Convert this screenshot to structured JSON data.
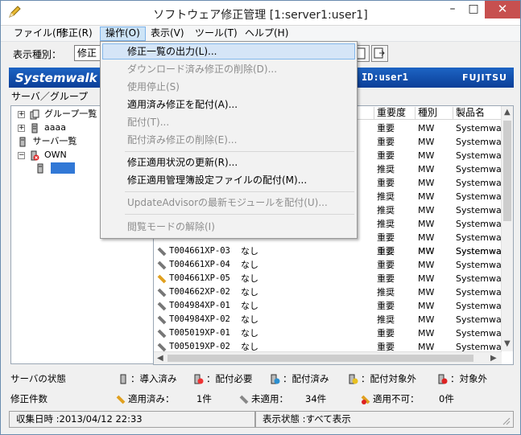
{
  "window": {
    "title": "ソフトウェア修正管理 [1:server1:user1]",
    "minimize": "–",
    "maximize": "□",
    "close": "✕"
  },
  "menubar": [
    {
      "label": "ファイル(F)"
    },
    {
      "label": "修正(R)"
    },
    {
      "label": "操作(O)"
    },
    {
      "label": "表示(V)"
    },
    {
      "label": "ツール(T)"
    },
    {
      "label": "ヘルプ(H)"
    }
  ],
  "toolbar": {
    "display_type_label": "表示種別：",
    "display_type_value": "修正"
  },
  "banner": {
    "logo": "Systemwalk",
    "user": "ID:user1",
    "brand": "FUJITSU"
  },
  "tree": {
    "header": "サーバ／グループ",
    "nodes": [
      {
        "label": "グループ一覧",
        "expander": "+"
      },
      {
        "label": "aaaa",
        "expander": "+"
      },
      {
        "label": "サーバ一覧",
        "expander": ""
      },
      {
        "label": "OWN",
        "expander": "−"
      },
      {
        "label": "",
        "expander": ""
      }
    ]
  },
  "list": {
    "columns": {
      "importance": "重要度",
      "kind": "種別",
      "product": "製品名"
    },
    "top_rows": [
      {
        "importance": "重要",
        "kind": "MW",
        "product": "Systemwa"
      },
      {
        "importance": "重要",
        "kind": "MW",
        "product": "Systemwa"
      },
      {
        "importance": "重要",
        "kind": "MW",
        "product": "Systemwa"
      },
      {
        "importance": "推奨",
        "kind": "MW",
        "product": "Systemwa"
      },
      {
        "importance": "重要",
        "kind": "MW",
        "product": "Systemwa"
      },
      {
        "importance": "推奨",
        "kind": "MW",
        "product": "Systemwa"
      },
      {
        "importance": "推奨",
        "kind": "MW",
        "product": "Systemwa"
      },
      {
        "importance": "推奨",
        "kind": "MW",
        "product": "Systemwa"
      },
      {
        "importance": "重要",
        "kind": "MW",
        "product": "Systemwa"
      },
      {
        "importance": "重要",
        "kind": "MW",
        "product": "Systemwa"
      }
    ],
    "rows": [
      {
        "id": "T004661XP-03",
        "status": "なし",
        "importance": "重要",
        "kind": "MW",
        "product": "Systemwa",
        "icon": "patch"
      },
      {
        "id": "T004661XP-04",
        "status": "なし",
        "importance": "重要",
        "kind": "MW",
        "product": "Systemwa",
        "icon": "patch"
      },
      {
        "id": "T004661XP-05",
        "status": "なし",
        "importance": "重要",
        "kind": "MW",
        "product": "Systemwa",
        "icon": "applied"
      },
      {
        "id": "T004662XP-02",
        "status": "なし",
        "importance": "推奨",
        "kind": "MW",
        "product": "Systemwa",
        "icon": "patch"
      },
      {
        "id": "T004984XP-01",
        "status": "なし",
        "importance": "重要",
        "kind": "MW",
        "product": "Systemwa",
        "icon": "patch"
      },
      {
        "id": "T004984XP-02",
        "status": "なし",
        "importance": "推奨",
        "kind": "MW",
        "product": "Systemwa",
        "icon": "patch"
      },
      {
        "id": "T005019XP-01",
        "status": "なし",
        "importance": "重要",
        "kind": "MW",
        "product": "Systemwa",
        "icon": "patch"
      },
      {
        "id": "T005019XP-02",
        "status": "なし",
        "importance": "重要",
        "kind": "MW",
        "product": "Systemwa",
        "icon": "patch"
      }
    ]
  },
  "legend": {
    "server_state_label": "サーバの状態",
    "installed": "：導入済み",
    "dist_required": "：配付必要",
    "distributed": "：配付済み",
    "dist_excluded": "：配付対象外",
    "excluded": "：対象外",
    "fix_count_label": "修正件数",
    "applied_label": "適用済み：",
    "applied_count": "1件",
    "not_applied_label": "未適用：",
    "not_applied_count": "34件",
    "cannot_apply_label": "適用不可：",
    "cannot_apply_count": "0件"
  },
  "statusbar": {
    "collected": "収集日時 :2013/04/12 22:33",
    "display_state": "表示状態 :すべて表示"
  },
  "operation_menu": [
    {
      "label": "修正一覧の出力(L)...",
      "enabled": true,
      "highlighted": true
    },
    {
      "label": "ダウンロード済み修正の削除(D)...",
      "enabled": false
    },
    {
      "label": "使用停止(S)",
      "enabled": false
    },
    {
      "label": "適用済み修正を配付(A)...",
      "enabled": true
    },
    {
      "label": "配付(T)...",
      "enabled": false
    },
    {
      "label": "配付済み修正の削除(E)...",
      "enabled": false
    },
    {
      "label": "修正適用状況の更新(R)...",
      "enabled": true
    },
    {
      "label": "修正適用管理簿設定ファイルの配付(M)...",
      "enabled": true
    },
    {
      "label": "UpdateAdvisorの最新モジュールを配付(U)...",
      "enabled": false
    },
    {
      "label": "閲覧モードの解除(I)",
      "enabled": false
    }
  ]
}
